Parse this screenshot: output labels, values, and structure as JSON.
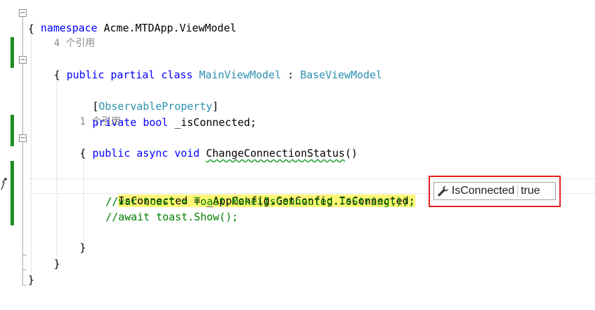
{
  "editor": {
    "line_namespace": {
      "keyword": "namespace",
      "name": " Acme.MTDApp.ViewModel"
    },
    "brace_open_ns": "{",
    "codelens_class": "4 个引用",
    "line_class": {
      "public": "public",
      "partial": "partial",
      "class": "class",
      "name": "MainViewModel",
      "colon": " : ",
      "base": "BaseViewModel"
    },
    "brace_open_class": "{",
    "attr_open": "[",
    "attr_name": "ObservableProperty",
    "attr_close": "]",
    "line_field": {
      "private": "private",
      "bool": "bool",
      "rest": " _isConnected;"
    },
    "codelens_method": "1 个引用",
    "line_method": {
      "public": "public",
      "async": "async",
      "void": "void",
      "name": "ChangeConnectionStatus",
      "parens": "()"
    },
    "brace_open_method": "{",
    "line_assign": "IsConnected = _AppConfig.GetConfig.IsConnected;",
    "line_comment1": "//var toast = Toast.Make(IsConnected.ToString());",
    "line_comment2": "//await toast.Show();",
    "brace_close_method": "}",
    "brace_close_class": "}",
    "brace_close_ns": "}"
  },
  "datatip": {
    "icon": "wrench-icon",
    "name": "IsConnected",
    "value": "true"
  },
  "colors": {
    "keyword": "#0000ff",
    "type": "#2b91af",
    "comment": "#008000",
    "highlight": "#fff675",
    "change_bar": "#1e8c1e",
    "frame": "#e02020"
  }
}
